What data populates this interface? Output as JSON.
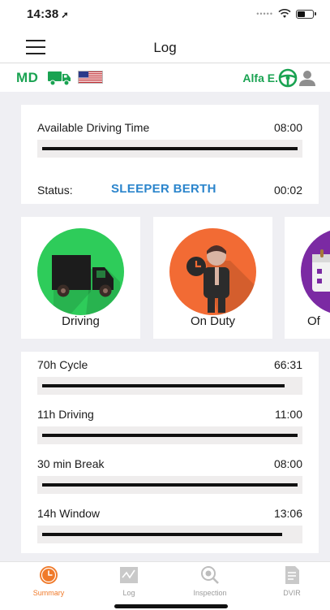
{
  "status_bar": {
    "time": "14:38"
  },
  "nav": {
    "title": "Log"
  },
  "info_bar": {
    "jurisdiction": "MD",
    "driver_name": "Alfa E."
  },
  "summary": {
    "available_label": "Available Driving Time",
    "available_value": "08:00",
    "available_progress": 1.0,
    "status_label": "Status:",
    "status_value": "SLEEPER BERTH",
    "status_time": "00:02"
  },
  "duty_tiles": [
    {
      "label": "Driving",
      "color": "#2ecc5a"
    },
    {
      "label": "On Duty",
      "color": "#f26b34"
    },
    {
      "label": "Of",
      "color": "#7b2aa3"
    }
  ],
  "clocks": [
    {
      "label": "70h Cycle",
      "value": "66:31",
      "progress": 0.95
    },
    {
      "label": "11h Driving",
      "value": "11:00",
      "progress": 1.0
    },
    {
      "label": "30 min Break",
      "value": "08:00",
      "progress": 1.0
    },
    {
      "label": "14h Window",
      "value": "13:06",
      "progress": 0.94
    }
  ],
  "tabs": [
    {
      "label": "Summary",
      "icon": "clock-icon",
      "active": true
    },
    {
      "label": "Log",
      "icon": "graph-icon",
      "active": false
    },
    {
      "label": "Inspection",
      "icon": "search-icon",
      "active": false
    },
    {
      "label": "DVIR",
      "icon": "document-icon",
      "active": false
    }
  ],
  "colors": {
    "accent_green": "#1aa352",
    "status_blue": "#2b85cc",
    "tab_active": "#f07a2a"
  }
}
